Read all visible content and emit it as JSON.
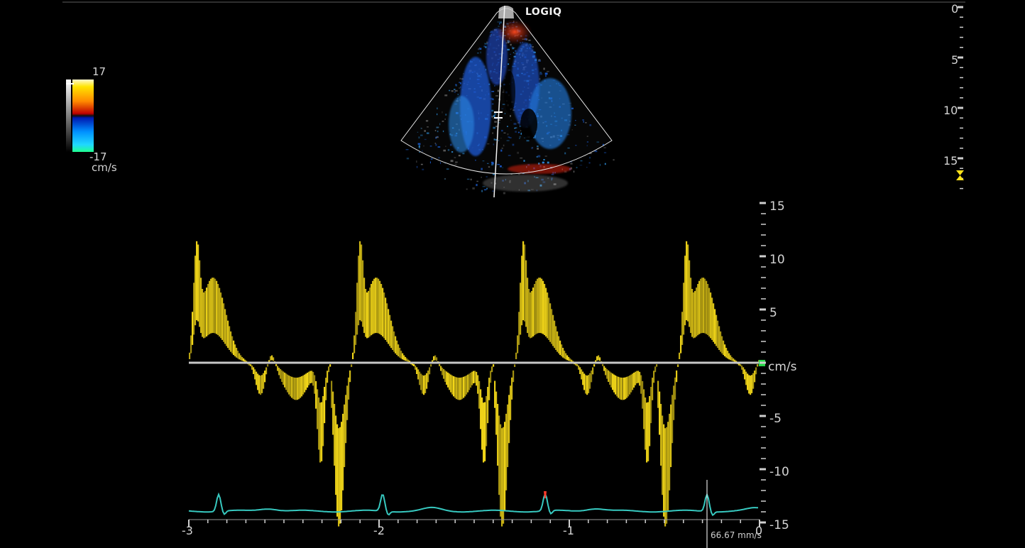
{
  "header": {
    "brand": "LOGIQ"
  },
  "color_scale": {
    "max_label": "17",
    "min_label": "-17",
    "unit_label": "cm/s"
  },
  "depth_scale": {
    "labels": [
      "0",
      "5",
      "10",
      "15"
    ]
  },
  "velocity_scale": {
    "labels": [
      "15",
      "10",
      "5",
      "-5",
      "-10",
      "-15"
    ],
    "unit_label": "cm/s"
  },
  "time_axis": {
    "labels": [
      "-3",
      "-2",
      "-1",
      "0"
    ]
  },
  "sweep": {
    "speed_label": "66.67 mm/s"
  },
  "colors": {
    "spectrum": "#ffe21a",
    "ecg": "#37c9c0",
    "baseline": "#c8c8c8",
    "baseline_marker": "#27d64a",
    "focus_marker": "#ffe21a",
    "ecg_trigger": "#ff3a2a"
  },
  "icons": {
    "focus_marker": "hourglass-focus-icon",
    "baseline_marker": "square-marker-icon",
    "ecg_trigger": "trigger-marker-icon"
  }
}
